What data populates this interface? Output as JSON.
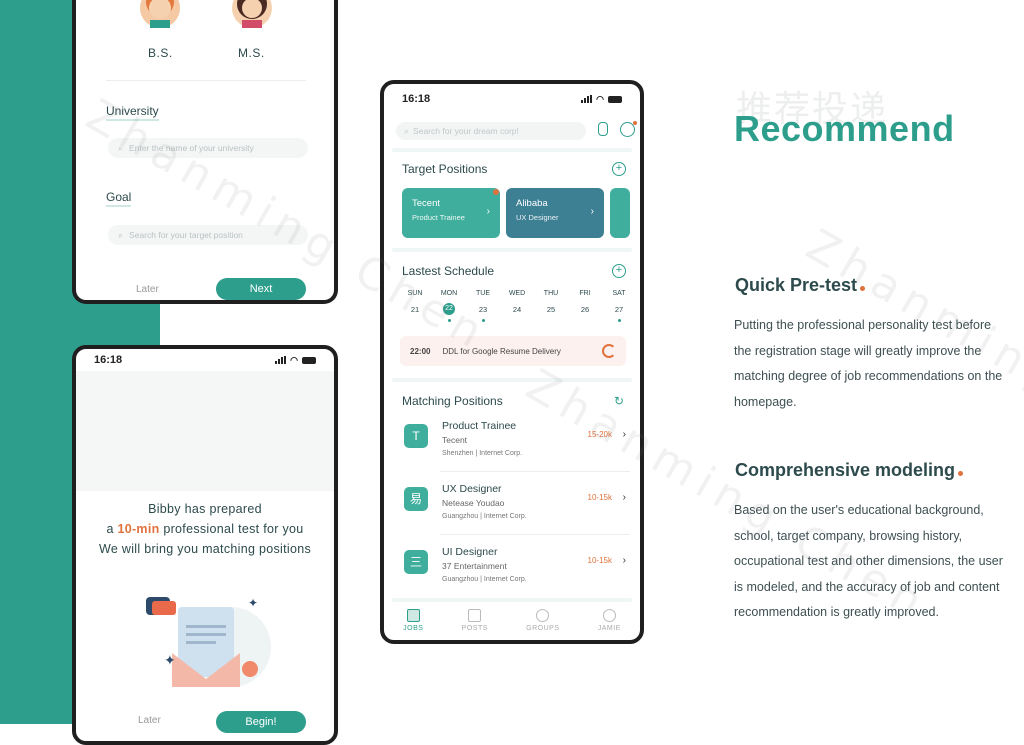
{
  "phone_education": {
    "degrees": [
      "B.S.",
      "M.S."
    ],
    "university_label": "University",
    "university_placeholder": "Enter the name of your university",
    "goal_label": "Goal",
    "goal_placeholder": "Search for your target position",
    "later_label": "Later",
    "next_label": "Next"
  },
  "phone_test": {
    "time": "16:18",
    "line1": "Bibby has prepared",
    "line2_pre": "a ",
    "line2_highlight": "10-min",
    "line2_post": " professional test for you",
    "line3": "We will bring you matching positions",
    "later_label": "Later",
    "begin_label": "Begin!"
  },
  "phone_home": {
    "time": "16:18",
    "search_placeholder": "Search for your dream corp!",
    "target_title": "Target Positions",
    "target_cards": [
      {
        "company": "Tecent",
        "role": "Product Trainee"
      },
      {
        "company": "Alibaba",
        "role": "UX Designer"
      }
    ],
    "schedule_title": "Lastest Schedule",
    "days": [
      "SUN",
      "MON",
      "TUE",
      "WED",
      "THU",
      "FRI",
      "SAT"
    ],
    "dates": [
      "21",
      "22",
      "23",
      "24",
      "25",
      "26",
      "27"
    ],
    "ddl_time": "22:00",
    "ddl_text": "DDL for Google Resume Delivery",
    "matching_title": "Matching Positions",
    "jobs": [
      {
        "icon": "T",
        "title": "Product Trainee",
        "company": "Tecent",
        "location": "Shenzhen | Internet Corp.",
        "salary": "15-20k"
      },
      {
        "icon": "易",
        "title": "UX Designer",
        "company": "Netease Youdao",
        "location": "Guangzhou | Internet Corp.",
        "salary": "10-15k"
      },
      {
        "icon": "三",
        "title": "UI Designer",
        "company": "37 Entertainment",
        "location": "Guangzhou | Internet Corp.",
        "salary": "10-15k"
      }
    ],
    "tabs": [
      "JOBS",
      "POSTS",
      "GROUPS",
      "JAMIE"
    ]
  },
  "side": {
    "cn_title": "推荐投递",
    "title": "Recommend",
    "h1": "Quick Pre-test",
    "p1": "Putting the professional personality test before the registration stage will greatly improve the matching degree of job recommendations on the homepage.",
    "h2": "Comprehensive modeling",
    "p2": "Based on the user's educational background, school, target company, browsing history, occupational test and other dimensions, the user is modeled, and the accuracy of job and content recommendation is greatly improved."
  },
  "watermark": "Zhanming Chen",
  "colors": {
    "accent": "#2e9e8c",
    "highlight": "#e0723e",
    "text": "#2d4a4c"
  }
}
